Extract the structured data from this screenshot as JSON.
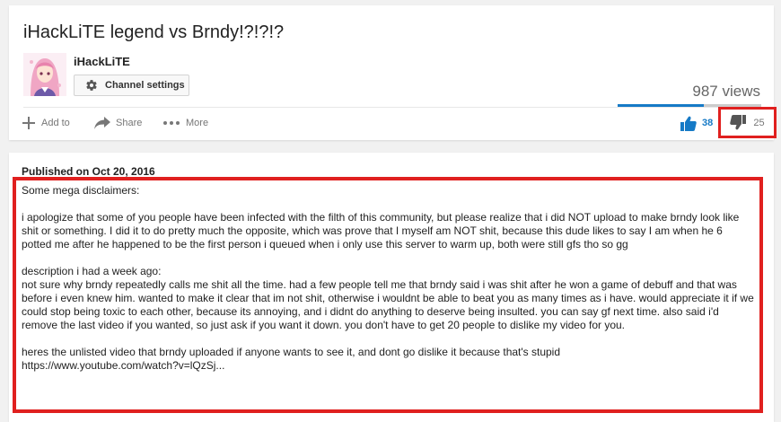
{
  "video": {
    "title": "iHackLiTE legend vs Brndy!?!?!?",
    "views": "987 views",
    "like_ratio": 0.6
  },
  "channel": {
    "name": "iHackLiTE",
    "settings_label": "Channel settings",
    "avatar_icon": "anime-avatar-icon"
  },
  "actions": {
    "add_label": "Add to",
    "share_label": "Share",
    "more_label": "More",
    "likes": "38",
    "dislikes": "25"
  },
  "description": {
    "published": "Published on Oct 20, 2016",
    "line1": "Some mega disclaimers:",
    "p1": "i apologize that some of you people have been infected with the filth of this community, but please realize that i did NOT upload to make brndy look like shit or something. I did it to do pretty much the opposite, which was prove that I myself am NOT shit, because this dude likes to say I am when he 6 potted me after he happened to be the first person i queued when i only use this server to warm up, both were still gfs tho so gg",
    "p2_title": "description i had a week ago:",
    "p2": "not sure why brndy repeatedly calls me shit all the time. had a few people tell me that brndy said i was shit after he won a game of debuff and that was before i even knew him. wanted to make it clear that im not shit, otherwise i wouldnt be able to beat you as many times as i have. would appreciate it if we could stop being toxic to each other, because its annoying, and i didnt do anything to deserve being insulted. you can say gf next time. also said i'd remove the last video if you wanted, so just ask if you want it down. you don't have to get 20 people to dislike my video for you.",
    "p3": "heres the unlisted video that brndy uploaded if anyone wants to see it, and dont go dislike it because that's stupid",
    "link": "https://www.youtube.com/watch?v=lQzSj..."
  },
  "colors": {
    "highlight": "#e0201f",
    "accent": "#167ac6"
  }
}
